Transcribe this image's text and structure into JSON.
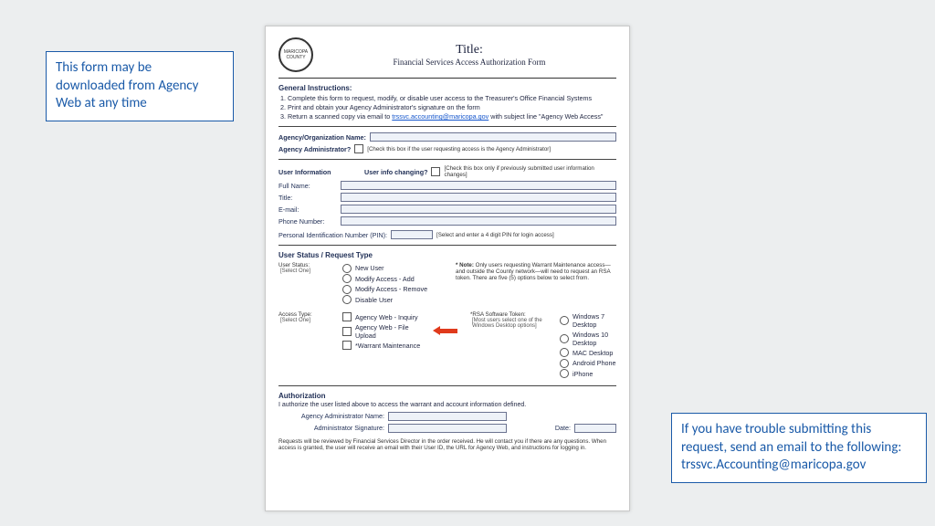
{
  "callouts": {
    "left": "This form may be downloaded from Agency Web at any time",
    "right_line1": "If you have trouble submitting this request, send an email to the following:",
    "right_email": "trssvc.Accounting@maricopa.gov"
  },
  "doc": {
    "title": "Title:",
    "subtitle": "Financial Services Access Authorization Form",
    "seal": "MARICOPA COUNTY",
    "general_instructions_head": "General Instructions:",
    "instructions": [
      "Complete this form to request, modify, or disable user access to the Treasurer's Office Financial Systems",
      "Print and obtain your Agency Administrator's signature on the form",
      "Return a scanned copy via email to "
    ],
    "instruction3_email": "trssvc.accounting@maricopa.gov",
    "instruction3_tail": " with subject line \"Agency Web Access\"",
    "agency_org_name_label": "Agency/Organization Name:",
    "agency_admin_label": "Agency Administrator?",
    "agency_admin_hint": "[Check this box if the user requesting access is the Agency Administrator]",
    "user_info_head": "User Information",
    "user_info_changing_label": "User info changing?",
    "user_info_changing_hint": "[Check this box only if previously submitted user information changes]",
    "fullname": "Full Name:",
    "email": "E-mail:",
    "phone": "Phone Number:",
    "pin_label": "Personal Identification Number (PIN):",
    "pin_hint": "[Select and enter a 4 digit PIN for login access]",
    "status_head": "User Status / Request Type",
    "user_status_label": "User Status:",
    "select_one": "[Select One]",
    "status_opts": [
      "New User",
      "Modify Access - Add",
      "Modify Access - Remove",
      "Disable User"
    ],
    "access_type_label": "Access Type:",
    "access_opts": [
      "Agency Web - Inquiry",
      "Agency Web - File Upload",
      "*Warrant Maintenance"
    ],
    "note_label": "* Note:",
    "note_text": "Only users requesting Warrant Maintenance access—and outside the County network—will need to request an RSA token. There are five (5) options below to select from.",
    "rsa_label": "*RSA Software Token:",
    "rsa_hint": "[Most users select one of the Windows Desktop options]",
    "rsa_opts": [
      "Windows 7 Desktop",
      "Windows 10 Desktop",
      "MAC Desktop",
      "Android Phone",
      "iPhone"
    ],
    "auth_head": "Authorization",
    "auth_text": "I authorize the user listed above to access the warrant and account information defined.",
    "admin_name_label": "Agency Administrator Name:",
    "admin_sig_label": "Administrator Signature:",
    "date_label": "Date:",
    "footer": "Requests will be reviewed by Financial Services Director in the order received. He will contact you if there are any questions. When access is granted, the user will receive an email with their User ID, the URL for Agency Web, and instructions for logging in."
  }
}
